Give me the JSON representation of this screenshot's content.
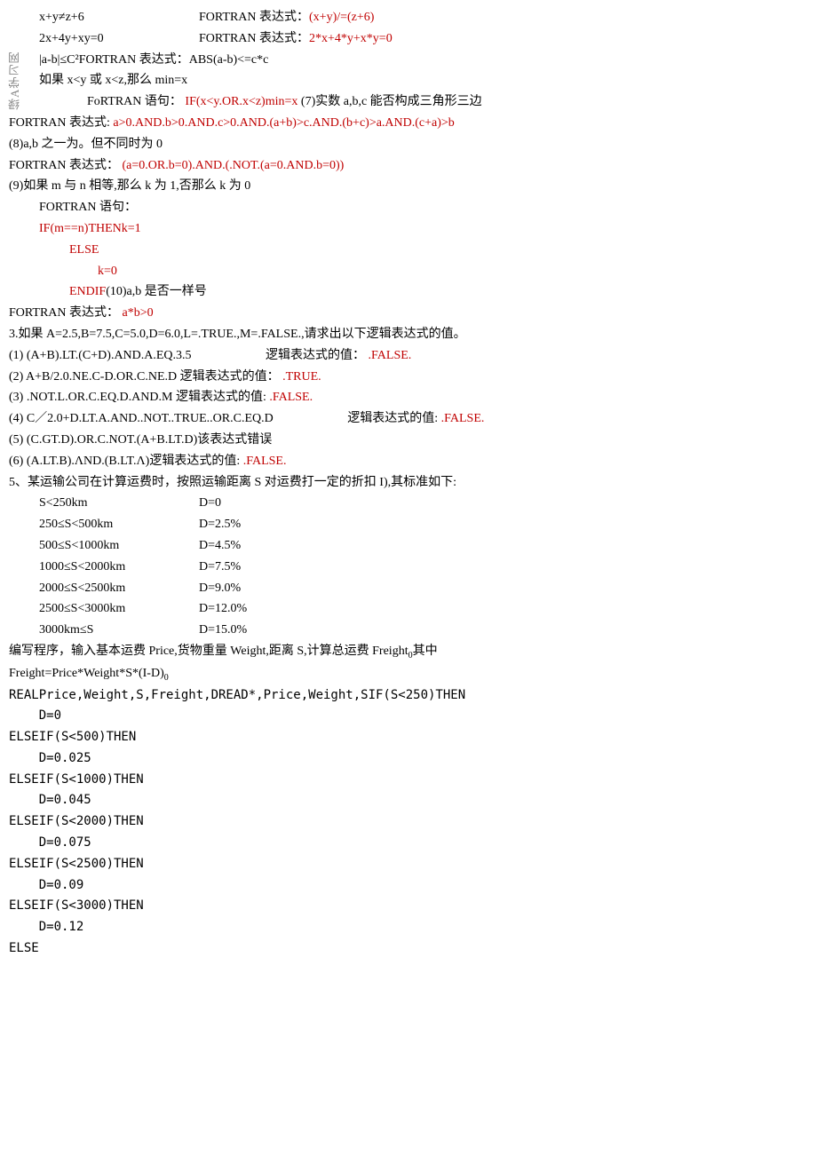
{
  "watermark": "绿A学习网",
  "l1": {
    "lhs": "x+y≠z+6",
    "lab": "FORTRAN 表达式：",
    "ans": "(x+y)/=(z+6)"
  },
  "l2": {
    "lhs": "2x+4y+xy=0",
    "lab": "FORTRAN 表达式：",
    "ans": "2*x+4*y+x*y=0"
  },
  "l3": "|a-b|≤C²FORTRAN 表达式：ABS(a-b)<=c*c",
  "l4": "如果 x<y 或 x<z,那么 min=x",
  "l5_lab": "FoRTRAN 语句：",
  "l5_ans": "IF(x<y.OR.x<z)min=x",
  "l5_trail": "(7)实数 a,b,c 能否构成三角形三边",
  "l6_lab": "FORTRAN 表达式:",
  "l6_ans": "a>0.AND.b>0.AND.c>0.AND.(a+b)>c.AND.(b+c)>a.AND.(c+a)>b",
  "l7": "(8)a,b 之一为。但不同时为 0",
  "l8_lab": "FORTRAN 表达式：",
  "l8_ans": "(a=0.OR.b=0).AND.(.NOT.(a=0.AND.b=0))",
  "l9": "(9)如果 m 与 n 相等,那么 k 为 1,否那么 k 为 0",
  "l10": "FORTRAN 语句：",
  "l11": "IF(m==n)THENk=1",
  "l12": "ELSE",
  "l13": "k=0",
  "l14": "ENDIF",
  "l14_trail": "(10)a,b 是否一样号",
  "l15_lab": "FORTRAN 表达式：",
  "l15_ans": "a*b>0",
  "l16": "3.如果 A=2.5,B=7.5,C=5.0,D=6.0,L=.TRUE.,M=.FALSE.,请求出以下逻辑表达式的值。",
  "q1": {
    "n": "(1)  (A+B).LT.(C+D).AND.A.EQ.3.5",
    "lab": "逻辑表达式的值：",
    "ans": ".FALSE."
  },
  "q2": {
    "n": "(2)  A+B/2.0.NE.C-D.OR.C.NE.D 逻辑表达式的值：",
    "ans": ".TRUE."
  },
  "q3": {
    "n": "(3)  .NOT.L.OR.C.EQ.D.AND.M 逻辑表达式的值:",
    "ans": ".FALSE."
  },
  "q4": {
    "n": "(4)  C／2.0+D.LT.A.AND..NOT..TRUE..OR.C.EQ.D",
    "lab": "逻辑表达式的值:",
    "ans": ".FALSE."
  },
  "q5": "(5)  (C.GT.D).OR.C.NOT.(A+B.LT.D)该表达式错误",
  "q6": {
    "n": "(6)  (A.LT.B).ΛND.(B.LT.Λ)逻辑表达式的值:",
    "ans": ".FALSE."
  },
  "p5": "5、某运输公司在计算运费时，按照运输距离 S 对运费打一定的折扣 I),其标准如下:",
  "table": [
    {
      "r": "S<250km",
      "d": "D=0"
    },
    {
      "r": "250≤S<500km",
      "d": "D=2.5%"
    },
    {
      "r": "500≤S<1000km",
      "d": "D=4.5%"
    },
    {
      "r": "1000≤S<2000km",
      "d": "D=7.5%"
    },
    {
      "r": "2000≤S<2500km",
      "d": "D=9.0%"
    },
    {
      "r": "2500≤S<3000km",
      "d": "D=12.0%"
    },
    {
      "r": "3000km≤S",
      "d": "D=15.0%"
    }
  ],
  "p5b1": "编写程序，输入基本运费 Price,货物重量 Weight,距离 S,计算总运费 Freight",
  "p5b1_sub": "0",
  "p5b1_tail": "其中",
  "p5b2a": "Freight=Price*Weight*S*(I-D)",
  "p5b2_sub": "0",
  "code": [
    "REALPrice,Weight,S,Freight,DREAD*,Price,Weight,SIF(S<250)THEN",
    "    D=0",
    "ELSEIF(S<500)THEN",
    "    D=0.025",
    "ELSEIF(S<1000)THEN",
    "    D=0.045",
    "ELSEIF(S<2000)THEN",
    "    D=0.075",
    "ELSEIF(S<2500)THEN",
    "    D=0.09",
    "ELSEIF(S<3000)THEN",
    "    D=0.12",
    "ELSE"
  ]
}
